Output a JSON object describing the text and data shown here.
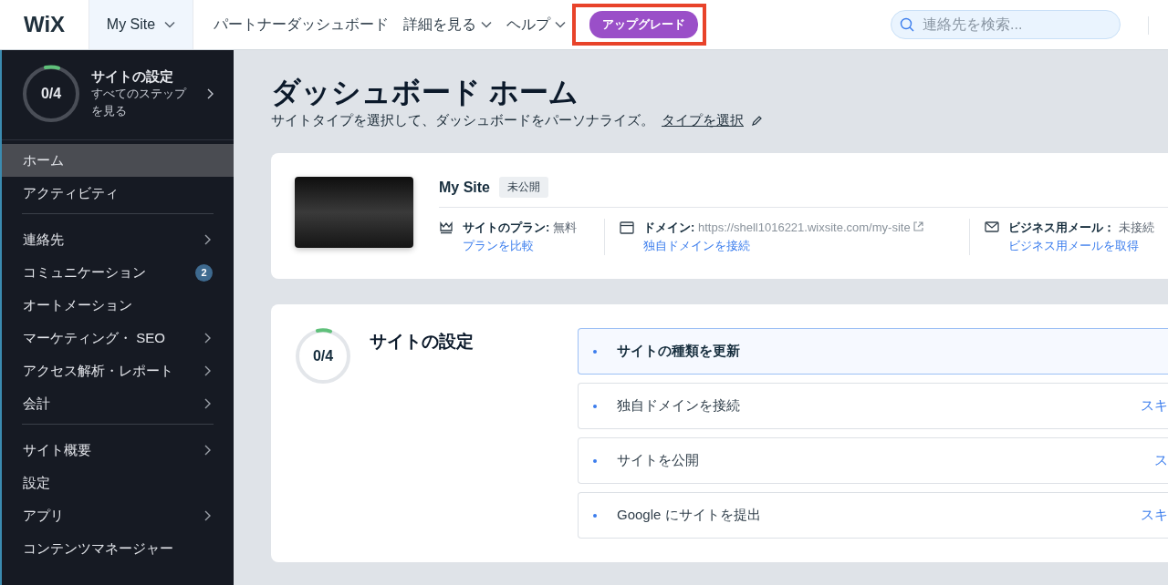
{
  "topbar": {
    "logo": "WiX",
    "site_switcher": "My Site",
    "nav": [
      {
        "label": "パートナーダッシュボード",
        "dropdown": false
      },
      {
        "label": "詳細を見る",
        "dropdown": true
      },
      {
        "label": "ヘルプ",
        "dropdown": true
      }
    ],
    "upgrade_button": {
      "label": "アップグレード",
      "highlighted": true
    },
    "search": {
      "placeholder": "連絡先を検索..."
    }
  },
  "sidebar": {
    "setup": {
      "count": "0/4",
      "title": "サイトの設定",
      "subtitle": "すべてのステップを見る"
    },
    "groups": [
      [
        {
          "label": "ホーム",
          "selected": true,
          "submenu": false
        },
        {
          "label": "アクティビティ",
          "selected": false,
          "submenu": false
        }
      ],
      [
        {
          "label": "連絡先",
          "selected": false,
          "submenu": true
        },
        {
          "label": "コミュニケーション",
          "selected": false,
          "submenu": false,
          "badge": "2"
        },
        {
          "label": "オートメーション",
          "selected": false,
          "submenu": false
        },
        {
          "label": "マーケティング・ SEO",
          "selected": false,
          "submenu": true
        },
        {
          "label": "アクセス解析・レポート",
          "selected": false,
          "submenu": true
        },
        {
          "label": "会計",
          "selected": false,
          "submenu": true
        }
      ],
      [
        {
          "label": "サイト概要",
          "selected": false,
          "submenu": true
        },
        {
          "label": "設定",
          "selected": false,
          "submenu": false
        },
        {
          "label": "アプリ",
          "selected": false,
          "submenu": true
        },
        {
          "label": "コンテンツマネージャー",
          "selected": false,
          "submenu": false
        }
      ]
    ]
  },
  "main": {
    "title": "ダッシュボード ホーム",
    "subtitle": "サイトタイプを選択して、ダッシュボードをパーソナライズ。",
    "subtitle_link": "タイプを選択",
    "site_card": {
      "name": "My Site",
      "status": "未公開",
      "info": [
        {
          "kind": "plan",
          "label": "サイトのプラン:",
          "value": "無料",
          "link": "プランを比較"
        },
        {
          "kind": "domain",
          "label": "ドメイン:",
          "value": "https://shell1016221.wixsite.com/my-site",
          "link": "独自ドメインを接続"
        },
        {
          "kind": "email",
          "label": "ビジネス用メール：",
          "value": "未接続",
          "link": "ビジネス用メールを取得"
        }
      ]
    },
    "setup_card": {
      "count": "0/4",
      "title": "サイトの設定",
      "steps": [
        {
          "label": "サイトの種類を更新",
          "selected": true
        },
        {
          "label": "独自ドメインを接続",
          "selected": false,
          "skip": "スキ"
        },
        {
          "label": "サイトを公開",
          "selected": false,
          "skip": "ス"
        },
        {
          "label": "Google にサイトを提出",
          "selected": false,
          "skip": "スキ"
        }
      ]
    }
  }
}
